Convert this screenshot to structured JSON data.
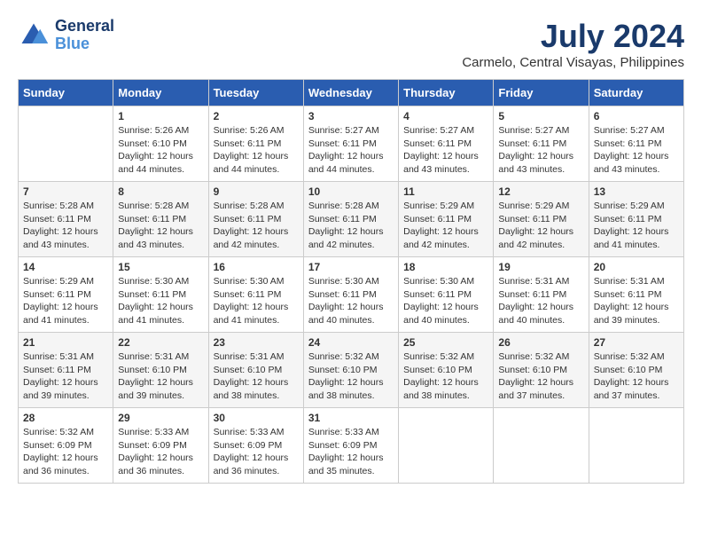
{
  "logo": {
    "text_general": "General",
    "text_blue": "Blue"
  },
  "title": {
    "month_year": "July 2024",
    "location": "Carmelo, Central Visayas, Philippines"
  },
  "calendar": {
    "headers": [
      "Sunday",
      "Monday",
      "Tuesday",
      "Wednesday",
      "Thursday",
      "Friday",
      "Saturday"
    ],
    "weeks": [
      [
        {
          "day": "",
          "info": ""
        },
        {
          "day": "1",
          "info": "Sunrise: 5:26 AM\nSunset: 6:10 PM\nDaylight: 12 hours\nand 44 minutes."
        },
        {
          "day": "2",
          "info": "Sunrise: 5:26 AM\nSunset: 6:11 PM\nDaylight: 12 hours\nand 44 minutes."
        },
        {
          "day": "3",
          "info": "Sunrise: 5:27 AM\nSunset: 6:11 PM\nDaylight: 12 hours\nand 44 minutes."
        },
        {
          "day": "4",
          "info": "Sunrise: 5:27 AM\nSunset: 6:11 PM\nDaylight: 12 hours\nand 43 minutes."
        },
        {
          "day": "5",
          "info": "Sunrise: 5:27 AM\nSunset: 6:11 PM\nDaylight: 12 hours\nand 43 minutes."
        },
        {
          "day": "6",
          "info": "Sunrise: 5:27 AM\nSunset: 6:11 PM\nDaylight: 12 hours\nand 43 minutes."
        }
      ],
      [
        {
          "day": "7",
          "info": "Sunrise: 5:28 AM\nSunset: 6:11 PM\nDaylight: 12 hours\nand 43 minutes."
        },
        {
          "day": "8",
          "info": "Sunrise: 5:28 AM\nSunset: 6:11 PM\nDaylight: 12 hours\nand 43 minutes."
        },
        {
          "day": "9",
          "info": "Sunrise: 5:28 AM\nSunset: 6:11 PM\nDaylight: 12 hours\nand 42 minutes."
        },
        {
          "day": "10",
          "info": "Sunrise: 5:28 AM\nSunset: 6:11 PM\nDaylight: 12 hours\nand 42 minutes."
        },
        {
          "day": "11",
          "info": "Sunrise: 5:29 AM\nSunset: 6:11 PM\nDaylight: 12 hours\nand 42 minutes."
        },
        {
          "day": "12",
          "info": "Sunrise: 5:29 AM\nSunset: 6:11 PM\nDaylight: 12 hours\nand 42 minutes."
        },
        {
          "day": "13",
          "info": "Sunrise: 5:29 AM\nSunset: 6:11 PM\nDaylight: 12 hours\nand 41 minutes."
        }
      ],
      [
        {
          "day": "14",
          "info": "Sunrise: 5:29 AM\nSunset: 6:11 PM\nDaylight: 12 hours\nand 41 minutes."
        },
        {
          "day": "15",
          "info": "Sunrise: 5:30 AM\nSunset: 6:11 PM\nDaylight: 12 hours\nand 41 minutes."
        },
        {
          "day": "16",
          "info": "Sunrise: 5:30 AM\nSunset: 6:11 PM\nDaylight: 12 hours\nand 41 minutes."
        },
        {
          "day": "17",
          "info": "Sunrise: 5:30 AM\nSunset: 6:11 PM\nDaylight: 12 hours\nand 40 minutes."
        },
        {
          "day": "18",
          "info": "Sunrise: 5:30 AM\nSunset: 6:11 PM\nDaylight: 12 hours\nand 40 minutes."
        },
        {
          "day": "19",
          "info": "Sunrise: 5:31 AM\nSunset: 6:11 PM\nDaylight: 12 hours\nand 40 minutes."
        },
        {
          "day": "20",
          "info": "Sunrise: 5:31 AM\nSunset: 6:11 PM\nDaylight: 12 hours\nand 39 minutes."
        }
      ],
      [
        {
          "day": "21",
          "info": "Sunrise: 5:31 AM\nSunset: 6:11 PM\nDaylight: 12 hours\nand 39 minutes."
        },
        {
          "day": "22",
          "info": "Sunrise: 5:31 AM\nSunset: 6:10 PM\nDaylight: 12 hours\nand 39 minutes."
        },
        {
          "day": "23",
          "info": "Sunrise: 5:31 AM\nSunset: 6:10 PM\nDaylight: 12 hours\nand 38 minutes."
        },
        {
          "day": "24",
          "info": "Sunrise: 5:32 AM\nSunset: 6:10 PM\nDaylight: 12 hours\nand 38 minutes."
        },
        {
          "day": "25",
          "info": "Sunrise: 5:32 AM\nSunset: 6:10 PM\nDaylight: 12 hours\nand 38 minutes."
        },
        {
          "day": "26",
          "info": "Sunrise: 5:32 AM\nSunset: 6:10 PM\nDaylight: 12 hours\nand 37 minutes."
        },
        {
          "day": "27",
          "info": "Sunrise: 5:32 AM\nSunset: 6:10 PM\nDaylight: 12 hours\nand 37 minutes."
        }
      ],
      [
        {
          "day": "28",
          "info": "Sunrise: 5:32 AM\nSunset: 6:09 PM\nDaylight: 12 hours\nand 36 minutes."
        },
        {
          "day": "29",
          "info": "Sunrise: 5:33 AM\nSunset: 6:09 PM\nDaylight: 12 hours\nand 36 minutes."
        },
        {
          "day": "30",
          "info": "Sunrise: 5:33 AM\nSunset: 6:09 PM\nDaylight: 12 hours\nand 36 minutes."
        },
        {
          "day": "31",
          "info": "Sunrise: 5:33 AM\nSunset: 6:09 PM\nDaylight: 12 hours\nand 35 minutes."
        },
        {
          "day": "",
          "info": ""
        },
        {
          "day": "",
          "info": ""
        },
        {
          "day": "",
          "info": ""
        }
      ]
    ]
  }
}
